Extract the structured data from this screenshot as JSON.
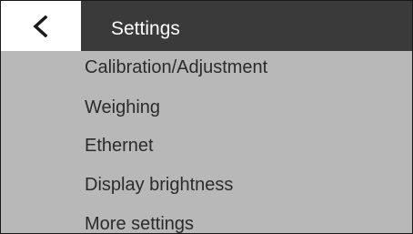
{
  "header": {
    "title": "Settings",
    "back_icon": "chevron-left-icon",
    "colors": {
      "header_bg": "#3a3a3a",
      "title_text": "#ffffff",
      "back_bg": "#ffffff",
      "back_icon": "#1a1a1a"
    }
  },
  "menu": {
    "items": [
      {
        "label": "Calibration/Adjustment"
      },
      {
        "label": "Weighing"
      },
      {
        "label": "Ethernet"
      },
      {
        "label": "Display brightness"
      },
      {
        "label": "More settings"
      }
    ],
    "colors": {
      "background": "#b8b8b8",
      "text": "#2b2b2b"
    }
  }
}
